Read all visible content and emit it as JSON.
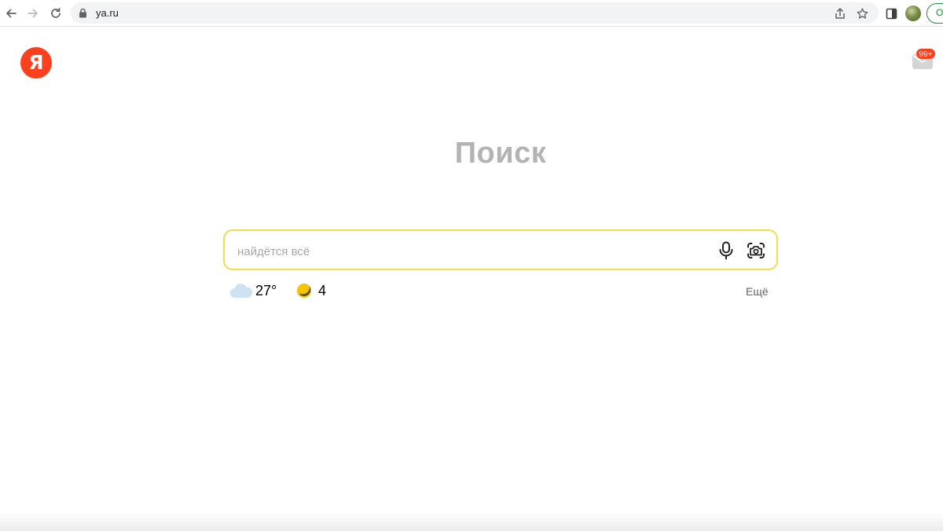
{
  "browser": {
    "url": "ya.ru",
    "profile_label": "О",
    "icons": {
      "back": "arrow-left-icon",
      "forward": "arrow-right-icon",
      "reload": "reload-icon",
      "lock": "lock-icon",
      "share": "share-icon",
      "bookmark": "star-icon",
      "sidebar": "side-panel-icon"
    }
  },
  "header": {
    "logo_letter": "Я",
    "mail_badge": "99+"
  },
  "main": {
    "title": "Поиск",
    "search": {
      "placeholder": "найдётся всё",
      "value": ""
    },
    "widgets": {
      "weather_temp": "27°",
      "traffic_score": "4",
      "more_label": "Ещё"
    }
  },
  "colors": {
    "brand_red": "#fc3f1d",
    "search_border": "#f3dd4c",
    "traffic_yellow": "#f6c400"
  }
}
